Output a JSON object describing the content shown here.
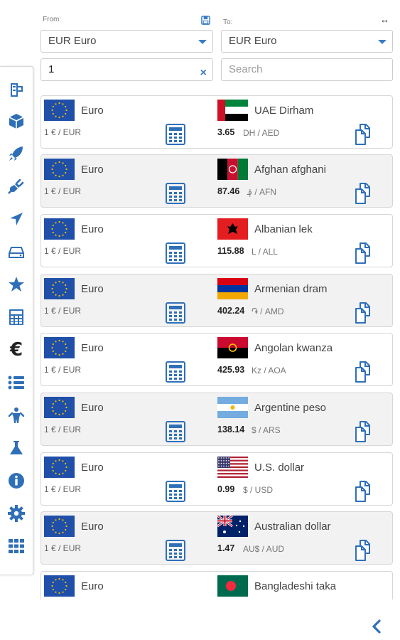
{
  "header": {
    "from_label": "From:",
    "to_label": "To:",
    "from_select": "EUR Euro",
    "to_select": "EUR Euro",
    "amount_value": "1",
    "search_placeholder": "Search",
    "clear_symbol": "×",
    "swap_symbol": "↔"
  },
  "sidebar": {
    "items": [
      "building-icon",
      "cube-icon",
      "rocket-icon",
      "plug-icon",
      "location-arrow-icon",
      "drive-icon",
      "star-icon",
      "calculator-icon",
      "euro-icon",
      "list-icon",
      "child-icon",
      "flask-icon",
      "info-icon",
      "gear-icon",
      "grid-icon"
    ],
    "euro_glyph": "€"
  },
  "rows": [
    {
      "from_name": "Euro",
      "from_value": "1 € / EUR",
      "to_name": "UAE Dirham",
      "rate": "3.65",
      "unit": "DH / AED",
      "flag": "ae"
    },
    {
      "from_name": "Euro",
      "from_value": "1 € / EUR",
      "to_name": "Afghan afghani",
      "rate": "87.46",
      "unit": "؋ / AFN",
      "flag": "af"
    },
    {
      "from_name": "Euro",
      "from_value": "1 € / EUR",
      "to_name": "Albanian lek",
      "rate": "115.88",
      "unit": "L / ALL",
      "flag": "al"
    },
    {
      "from_name": "Euro",
      "from_value": "1 € / EUR",
      "to_name": "Armenian dram",
      "rate": "402.24",
      "unit": "֏ / AMD",
      "flag": "am"
    },
    {
      "from_name": "Euro",
      "from_value": "1 € / EUR",
      "to_name": "Angolan kwanza",
      "rate": "425.93",
      "unit": "Kz / AOA",
      "flag": "ao"
    },
    {
      "from_name": "Euro",
      "from_value": "1 € / EUR",
      "to_name": "Argentine peso",
      "rate": "138.14",
      "unit": "$ / ARS",
      "flag": "ar"
    },
    {
      "from_name": "Euro",
      "from_value": "1 € / EUR",
      "to_name": "U.S. dollar",
      "rate": "0.99",
      "unit": "$ / USD",
      "flag": "us"
    },
    {
      "from_name": "Euro",
      "from_value": "1 € / EUR",
      "to_name": "Australian dollar",
      "rate": "1.47",
      "unit": "AU$ / AUD",
      "flag": "au"
    },
    {
      "from_name": "Euro",
      "from_value": "",
      "to_name": "Bangladeshi taka",
      "rate": "",
      "unit": "",
      "flag": "bd"
    }
  ],
  "colors": {
    "accent": "#3a7cc4",
    "eu_blue": "#1f4fa8",
    "eu_star": "#f2c200"
  }
}
